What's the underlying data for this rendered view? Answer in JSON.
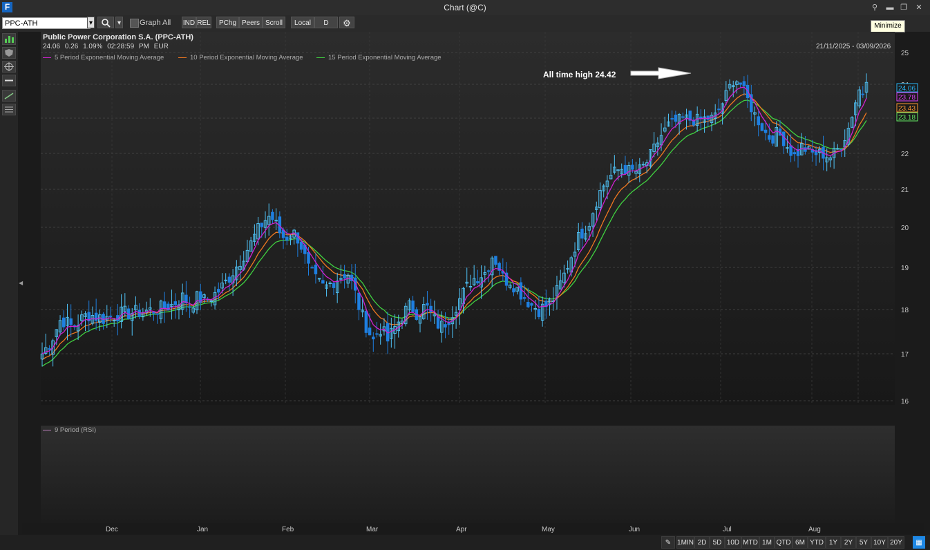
{
  "window": {
    "title": "Chart (@C)",
    "logo": "F"
  },
  "toolbar": {
    "symbol": "PPC-ATH",
    "graph_all_label": "Graph All",
    "buttons": [
      "IND",
      "REL",
      "PChg",
      "Peers",
      "Scroll",
      "Local",
      "D"
    ],
    "tooltip": "Minimize"
  },
  "header": {
    "title": "Public Power Corporation S.A. (PPC-ATH)",
    "last": "24.06",
    "change": "0.26",
    "change_pct": "1.09%",
    "time": "02:28:59 PM",
    "currency": "EUR",
    "date_range": "21/11/2025 - 03/09/2026"
  },
  "legend": [
    {
      "label": "5 Period Exponential Moving Average",
      "color": "#d020d0"
    },
    {
      "label": "10 Period Exponential Moving Average",
      "color": "#f07820"
    },
    {
      "label": "15 Period Exponential Moving Average",
      "color": "#40d040"
    }
  ],
  "annotation": {
    "text": "All time high 24.42"
  },
  "rsi": {
    "label": "9 Period (RSI)"
  },
  "periods": [
    "1MIN",
    "2D",
    "5D",
    "10D",
    "MTD",
    "1M",
    "QTD",
    "6M",
    "YTD",
    "1Y",
    "2Y",
    "5Y",
    "10Y",
    "20Y"
  ],
  "chart_data": {
    "type": "line",
    "ylim": [
      16,
      25
    ],
    "y_ticks": [
      "25",
      "24",
      "23",
      "22",
      "21",
      "20",
      "19",
      "18",
      "17",
      "16"
    ],
    "months": [
      "Dec",
      "Jan",
      "Feb",
      "Mar",
      "Apr",
      "May",
      "Jun",
      "Jul",
      "Aug"
    ],
    "price_tags": [
      {
        "value": "24.06",
        "color": "#29b6f6"
      },
      {
        "value": "23.78",
        "color": "#e040fb"
      },
      {
        "value": "23.43",
        "color": "#ff9933"
      },
      {
        "value": "23.18",
        "color": "#66ee66"
      }
    ],
    "close_path": [
      {
        "t": 0.0,
        "v": 17.0
      },
      {
        "t": 0.012,
        "v": 17.3
      },
      {
        "t": 0.025,
        "v": 17.8
      },
      {
        "t": 0.04,
        "v": 17.6
      },
      {
        "t": 0.06,
        "v": 17.9
      },
      {
        "t": 0.08,
        "v": 17.8
      },
      {
        "t": 0.1,
        "v": 17.9
      },
      {
        "t": 0.13,
        "v": 17.95
      },
      {
        "t": 0.15,
        "v": 18.0
      },
      {
        "t": 0.17,
        "v": 18.1
      },
      {
        "t": 0.185,
        "v": 18.3
      },
      {
        "t": 0.195,
        "v": 18.1
      },
      {
        "t": 0.205,
        "v": 18.3
      },
      {
        "t": 0.215,
        "v": 18.2
      },
      {
        "t": 0.23,
        "v": 18.4
      },
      {
        "t": 0.24,
        "v": 18.6
      },
      {
        "t": 0.255,
        "v": 19.0
      },
      {
        "t": 0.265,
        "v": 19.3
      },
      {
        "t": 0.275,
        "v": 19.6
      },
      {
        "t": 0.283,
        "v": 19.9
      },
      {
        "t": 0.29,
        "v": 20.1
      },
      {
        "t": 0.298,
        "v": 20.3
      },
      {
        "t": 0.305,
        "v": 20.2
      },
      {
        "t": 0.312,
        "v": 19.9
      },
      {
        "t": 0.32,
        "v": 19.7
      },
      {
        "t": 0.328,
        "v": 19.9
      },
      {
        "t": 0.335,
        "v": 19.8
      },
      {
        "t": 0.342,
        "v": 19.5
      },
      {
        "t": 0.35,
        "v": 19.0
      },
      {
        "t": 0.36,
        "v": 18.7
      },
      {
        "t": 0.372,
        "v": 18.5
      },
      {
        "t": 0.385,
        "v": 18.7
      },
      {
        "t": 0.395,
        "v": 18.8
      },
      {
        "t": 0.402,
        "v": 18.9
      },
      {
        "t": 0.412,
        "v": 18.4
      },
      {
        "t": 0.42,
        "v": 17.9
      },
      {
        "t": 0.428,
        "v": 17.6
      },
      {
        "t": 0.436,
        "v": 17.3
      },
      {
        "t": 0.445,
        "v": 17.6
      },
      {
        "t": 0.455,
        "v": 17.3
      },
      {
        "t": 0.465,
        "v": 17.6
      },
      {
        "t": 0.475,
        "v": 17.9
      },
      {
        "t": 0.485,
        "v": 18.1
      },
      {
        "t": 0.495,
        "v": 17.9
      },
      {
        "t": 0.505,
        "v": 18.1
      },
      {
        "t": 0.515,
        "v": 17.8
      },
      {
        "t": 0.525,
        "v": 17.6
      },
      {
        "t": 0.535,
        "v": 17.8
      },
      {
        "t": 0.545,
        "v": 18.1
      },
      {
        "t": 0.555,
        "v": 18.4
      },
      {
        "t": 0.565,
        "v": 18.7
      },
      {
        "t": 0.575,
        "v": 18.8
      },
      {
        "t": 0.585,
        "v": 18.9
      },
      {
        "t": 0.592,
        "v": 19.3
      },
      {
        "t": 0.6,
        "v": 19.1
      },
      {
        "t": 0.608,
        "v": 18.7
      },
      {
        "t": 0.616,
        "v": 18.7
      },
      {
        "t": 0.625,
        "v": 18.5
      },
      {
        "t": 0.635,
        "v": 18.3
      },
      {
        "t": 0.645,
        "v": 18.1
      },
      {
        "t": 0.655,
        "v": 18.0
      },
      {
        "t": 0.665,
        "v": 18.1
      },
      {
        "t": 0.675,
        "v": 18.3
      },
      {
        "t": 0.685,
        "v": 18.7
      },
      {
        "t": 0.695,
        "v": 19.2
      },
      {
        "t": 0.705,
        "v": 19.7
      },
      {
        "t": 0.712,
        "v": 19.9
      },
      {
        "t": 0.72,
        "v": 20.1
      },
      {
        "t": 0.728,
        "v": 20.6
      },
      {
        "t": 0.736,
        "v": 21.0
      },
      {
        "t": 0.745,
        "v": 21.3
      },
      {
        "t": 0.755,
        "v": 21.5
      },
      {
        "t": 0.765,
        "v": 21.6
      },
      {
        "t": 0.775,
        "v": 21.5
      },
      {
        "t": 0.785,
        "v": 21.5
      },
      {
        "t": 0.795,
        "v": 21.7
      },
      {
        "t": 0.805,
        "v": 22.1
      },
      {
        "t": 0.815,
        "v": 22.5
      },
      {
        "t": 0.825,
        "v": 22.8
      },
      {
        "t": 0.835,
        "v": 22.9
      },
      {
        "t": 0.845,
        "v": 23.0
      },
      {
        "t": 0.855,
        "v": 22.95
      },
      {
        "t": 0.865,
        "v": 22.95
      },
      {
        "t": 0.875,
        "v": 23.0
      },
      {
        "t": 0.885,
        "v": 23.0
      },
      {
        "t": 0.895,
        "v": 23.4
      },
      {
        "t": 0.905,
        "v": 23.9
      },
      {
        "t": 0.912,
        "v": 24.2
      },
      {
        "t": 0.92,
        "v": 24.0
      },
      {
        "t": 0.928,
        "v": 23.6
      },
      {
        "t": 0.936,
        "v": 23.2
      },
      {
        "t": 0.944,
        "v": 22.9
      },
      {
        "t": 0.952,
        "v": 22.6
      },
      {
        "t": 0.96,
        "v": 22.4
      },
      {
        "t": 0.968,
        "v": 22.6
      },
      {
        "t": 0.976,
        "v": 22.4
      },
      {
        "t": 0.984,
        "v": 22.1
      },
      {
        "t": 0.992,
        "v": 21.9
      },
      {
        "t": 1.0,
        "v": 22.2
      }
    ],
    "close_path_tail": [
      {
        "t": 0.0,
        "v": 22.2
      },
      {
        "t": 0.15,
        "v": 22.0
      },
      {
        "t": 0.3,
        "v": 22.0
      },
      {
        "t": 0.45,
        "v": 21.9
      },
      {
        "t": 0.6,
        "v": 22.2
      },
      {
        "t": 0.72,
        "v": 22.7
      },
      {
        "t": 0.82,
        "v": 23.4
      },
      {
        "t": 0.9,
        "v": 23.9
      },
      {
        "t": 0.96,
        "v": 23.7
      },
      {
        "t": 1.0,
        "v": 24.06
      }
    ]
  }
}
